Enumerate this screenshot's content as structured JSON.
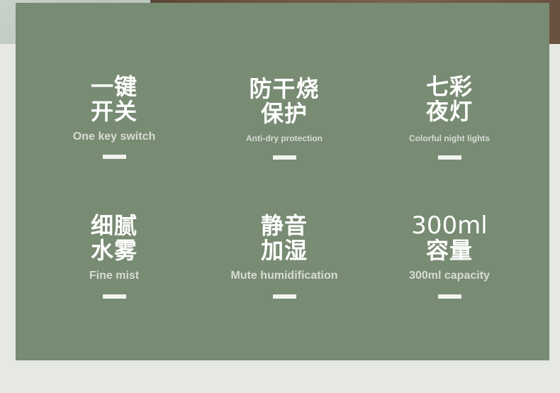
{
  "features": [
    {
      "title_lines": [
        "一键",
        "开关"
      ],
      "subtitle": "One key switch"
    },
    {
      "title_lines": [
        "防干烧",
        "保护"
      ],
      "subtitle": "Anti-dry protection"
    },
    {
      "title_lines": [
        "七彩",
        "夜灯"
      ],
      "subtitle": "Colorful night lights"
    },
    {
      "title_lines": [
        "细腻",
        "水雾"
      ],
      "subtitle": "Fine mist"
    },
    {
      "title_lines": [
        "静音",
        "加湿"
      ],
      "subtitle": "Mute humidification"
    },
    {
      "title_lines": [
        "300ml",
        "容量"
      ],
      "subtitle": "300ml capacity"
    }
  ],
  "colors": {
    "panel": "#788b73",
    "title": "#ffffff",
    "subtitle": "#d7dcd4",
    "dash": "#f1f2ee",
    "page_background": "#e6e8e4"
  }
}
